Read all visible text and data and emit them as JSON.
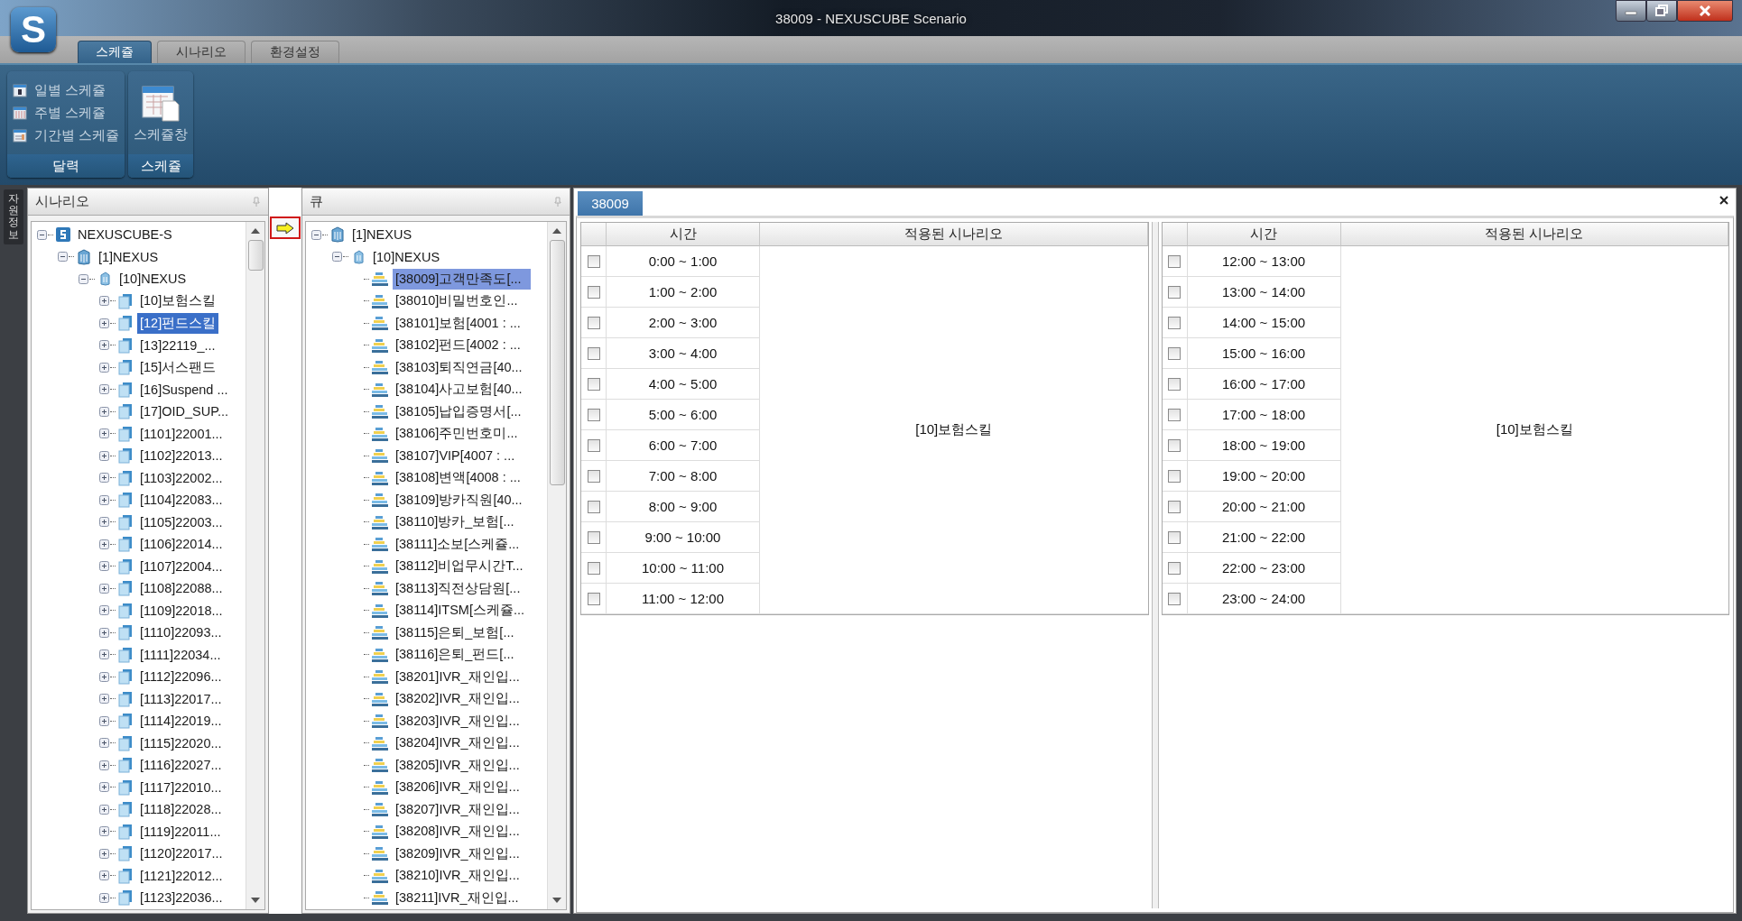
{
  "window": {
    "title": "38009 - NEXUSCUBE Scenario",
    "logo": "S"
  },
  "ribbon_tabs": [
    {
      "label": "스케쥴",
      "selected": true
    },
    {
      "label": "시나리오",
      "selected": false
    },
    {
      "label": "환경설정",
      "selected": false
    }
  ],
  "ribbon_groups": [
    {
      "label": "달력",
      "items": [
        {
          "kind": "day",
          "label": "일별 스케쥴"
        },
        {
          "kind": "week",
          "label": "주별 스케쥴"
        },
        {
          "kind": "period",
          "label": "기간별 스케쥴"
        }
      ]
    },
    {
      "label": "스케쥴",
      "items": [
        {
          "kind": "large",
          "label": "스케쥴창"
        }
      ]
    }
  ],
  "side_tab": "자원정보",
  "scenario_panel": {
    "title": "시나리오",
    "tree": [
      {
        "kind": "system",
        "label": "NEXUSCUBE-S",
        "expanded": true,
        "selected": false,
        "children": [
          {
            "kind": "center",
            "label": "[1]NEXUS",
            "expanded": true,
            "selected": false,
            "children": [
              {
                "kind": "site",
                "label": "[10]NEXUS",
                "expanded": true,
                "selected": false,
                "children": [
                  {
                    "kind": "skill",
                    "label": "[10]보험스킬",
                    "expanded": false,
                    "selected": false
                  },
                  {
                    "kind": "skill",
                    "label": "[12]펀드스킬",
                    "expanded": false,
                    "selected": true
                  },
                  {
                    "kind": "skill",
                    "label": "[13]22119_...",
                    "expanded": false,
                    "selected": false
                  },
                  {
                    "kind": "skill",
                    "label": "[15]서스팬드",
                    "expanded": false,
                    "selected": false
                  },
                  {
                    "kind": "skill",
                    "label": "[16]Suspend ...",
                    "expanded": false,
                    "selected": false
                  },
                  {
                    "kind": "skill",
                    "label": "[17]OID_SUP...",
                    "expanded": false,
                    "selected": false
                  },
                  {
                    "kind": "skill",
                    "label": "[1101]22001...",
                    "expanded": false,
                    "selected": false
                  },
                  {
                    "kind": "skill",
                    "label": "[1102]22013...",
                    "expanded": false,
                    "selected": false
                  },
                  {
                    "kind": "skill",
                    "label": "[1103]22002...",
                    "expanded": false,
                    "selected": false
                  },
                  {
                    "kind": "skill",
                    "label": "[1104]22083...",
                    "expanded": false,
                    "selected": false
                  },
                  {
                    "kind": "skill",
                    "label": "[1105]22003...",
                    "expanded": false,
                    "selected": false
                  },
                  {
                    "kind": "skill",
                    "label": "[1106]22014...",
                    "expanded": false,
                    "selected": false
                  },
                  {
                    "kind": "skill",
                    "label": "[1107]22004...",
                    "expanded": false,
                    "selected": false
                  },
                  {
                    "kind": "skill",
                    "label": "[1108]22088...",
                    "expanded": false,
                    "selected": false
                  },
                  {
                    "kind": "skill",
                    "label": "[1109]22018...",
                    "expanded": false,
                    "selected": false
                  },
                  {
                    "kind": "skill",
                    "label": "[1110]22093...",
                    "expanded": false,
                    "selected": false
                  },
                  {
                    "kind": "skill",
                    "label": "[1111]22034...",
                    "expanded": false,
                    "selected": false
                  },
                  {
                    "kind": "skill",
                    "label": "[1112]22096...",
                    "expanded": false,
                    "selected": false
                  },
                  {
                    "kind": "skill",
                    "label": "[1113]22017...",
                    "expanded": false,
                    "selected": false
                  },
                  {
                    "kind": "skill",
                    "label": "[1114]22019...",
                    "expanded": false,
                    "selected": false
                  },
                  {
                    "kind": "skill",
                    "label": "[1115]22020...",
                    "expanded": false,
                    "selected": false
                  },
                  {
                    "kind": "skill",
                    "label": "[1116]22027...",
                    "expanded": false,
                    "selected": false
                  },
                  {
                    "kind": "skill",
                    "label": "[1117]22010...",
                    "expanded": false,
                    "selected": false
                  },
                  {
                    "kind": "skill",
                    "label": "[1118]22028...",
                    "expanded": false,
                    "selected": false
                  },
                  {
                    "kind": "skill",
                    "label": "[1119]22011...",
                    "expanded": false,
                    "selected": false
                  },
                  {
                    "kind": "skill",
                    "label": "[1120]22017...",
                    "expanded": false,
                    "selected": false
                  },
                  {
                    "kind": "skill",
                    "label": "[1121]22012...",
                    "expanded": false,
                    "selected": false
                  },
                  {
                    "kind": "skill",
                    "label": "[1123]22036...",
                    "expanded": false,
                    "selected": false
                  }
                ]
              }
            ]
          }
        ]
      }
    ]
  },
  "queue_panel": {
    "title": "큐",
    "tree": [
      {
        "kind": "center",
        "label": "[1]NEXUS",
        "expanded": true,
        "selected": false,
        "children": [
          {
            "kind": "site",
            "label": "[10]NEXUS",
            "expanded": true,
            "selected": false,
            "children": [
              {
                "kind": "queue",
                "label": "[38009]고객만족도[...",
                "selected": true
              },
              {
                "kind": "queue",
                "label": "[38010]비밀번호인...",
                "selected": false
              },
              {
                "kind": "queue",
                "label": "[38101]보험[4001 : ...",
                "selected": false
              },
              {
                "kind": "queue",
                "label": "[38102]펀드[4002 : ...",
                "selected": false
              },
              {
                "kind": "queue",
                "label": "[38103]퇴직연금[40...",
                "selected": false
              },
              {
                "kind": "queue",
                "label": "[38104]사고보험[40...",
                "selected": false
              },
              {
                "kind": "queue",
                "label": "[38105]납입증명서[...",
                "selected": false
              },
              {
                "kind": "queue",
                "label": "[38106]주민번호미...",
                "selected": false
              },
              {
                "kind": "queue",
                "label": "[38107]VIP[4007 : ...",
                "selected": false
              },
              {
                "kind": "queue",
                "label": "[38108]변액[4008 : ...",
                "selected": false
              },
              {
                "kind": "queue",
                "label": "[38109]방카직원[40...",
                "selected": false
              },
              {
                "kind": "queue",
                "label": "[38110]방카_보험[...",
                "selected": false
              },
              {
                "kind": "queue",
                "label": "[38111]소보[스케쥴...",
                "selected": false
              },
              {
                "kind": "queue",
                "label": "[38112]비업무시간T...",
                "selected": false
              },
              {
                "kind": "queue",
                "label": "[38113]직전상담원[...",
                "selected": false
              },
              {
                "kind": "queue",
                "label": "[38114]ITSM[스케쥴...",
                "selected": false
              },
              {
                "kind": "queue",
                "label": "[38115]은퇴_보험[...",
                "selected": false
              },
              {
                "kind": "queue",
                "label": "[38116]은퇴_펀드[...",
                "selected": false
              },
              {
                "kind": "queue",
                "label": "[38201]IVR_재인입...",
                "selected": false
              },
              {
                "kind": "queue",
                "label": "[38202]IVR_재인입...",
                "selected": false
              },
              {
                "kind": "queue",
                "label": "[38203]IVR_재인입...",
                "selected": false
              },
              {
                "kind": "queue",
                "label": "[38204]IVR_재인입...",
                "selected": false
              },
              {
                "kind": "queue",
                "label": "[38205]IVR_재인입...",
                "selected": false
              },
              {
                "kind": "queue",
                "label": "[38206]IVR_재인입...",
                "selected": false
              },
              {
                "kind": "queue",
                "label": "[38207]IVR_재인입...",
                "selected": false
              },
              {
                "kind": "queue",
                "label": "[38208]IVR_재인입...",
                "selected": false
              },
              {
                "kind": "queue",
                "label": "[38209]IVR_재인입...",
                "selected": false
              },
              {
                "kind": "queue",
                "label": "[38210]IVR_재인입...",
                "selected": false
              },
              {
                "kind": "queue",
                "label": "[38211]IVR_재인입...",
                "selected": false
              }
            ]
          }
        ]
      }
    ]
  },
  "document_tab": {
    "label": "38009"
  },
  "schedule_tables": [
    {
      "columns": {
        "time": "시간",
        "scenario": "적용된 시나리오"
      },
      "applied_scenario": "[10]보험스킬",
      "rows": [
        {
          "time": "0:00 ~ 1:00",
          "checked": false
        },
        {
          "time": "1:00 ~ 2:00",
          "checked": false
        },
        {
          "time": "2:00 ~ 3:00",
          "checked": false
        },
        {
          "time": "3:00 ~ 4:00",
          "checked": false
        },
        {
          "time": "4:00 ~ 5:00",
          "checked": false
        },
        {
          "time": "5:00 ~ 6:00",
          "checked": false
        },
        {
          "time": "6:00 ~ 7:00",
          "checked": false
        },
        {
          "time": "7:00 ~ 8:00",
          "checked": false
        },
        {
          "time": "8:00 ~ 9:00",
          "checked": false
        },
        {
          "time": "9:00 ~ 10:00",
          "checked": false
        },
        {
          "time": "10:00 ~ 11:00",
          "checked": false
        },
        {
          "time": "11:00 ~ 12:00",
          "checked": false
        }
      ]
    },
    {
      "columns": {
        "time": "시간",
        "scenario": "적용된 시나리오"
      },
      "applied_scenario": "[10]보험스킬",
      "rows": [
        {
          "time": "12:00 ~ 13:00",
          "checked": false
        },
        {
          "time": "13:00 ~ 14:00",
          "checked": false
        },
        {
          "time": "14:00 ~ 15:00",
          "checked": false
        },
        {
          "time": "15:00 ~ 16:00",
          "checked": false
        },
        {
          "time": "16:00 ~ 17:00",
          "checked": false
        },
        {
          "time": "17:00 ~ 18:00",
          "checked": false
        },
        {
          "time": "18:00 ~ 19:00",
          "checked": false
        },
        {
          "time": "19:00 ~ 20:00",
          "checked": false
        },
        {
          "time": "20:00 ~ 21:00",
          "checked": false
        },
        {
          "time": "21:00 ~ 22:00",
          "checked": false
        },
        {
          "time": "22:00 ~ 23:00",
          "checked": false
        },
        {
          "time": "23:00 ~ 24:00",
          "checked": false
        }
      ]
    }
  ]
}
